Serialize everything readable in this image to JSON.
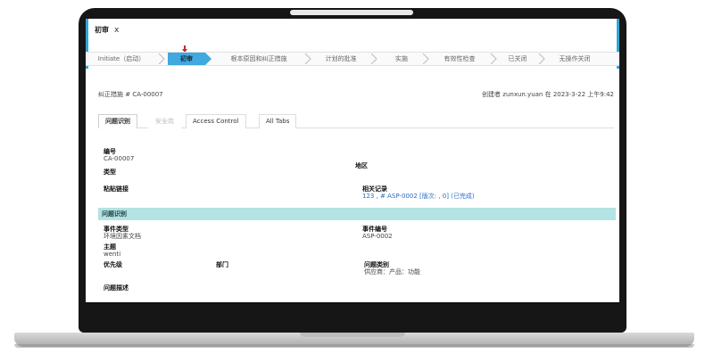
{
  "tab": {
    "label": "初审",
    "close": "x"
  },
  "path": {
    "stages": [
      {
        "label": "Initiate（启动）",
        "active": false
      },
      {
        "label": "初审",
        "active": true
      },
      {
        "label": "根本原因和纠正措施",
        "active": false
      },
      {
        "label": "计划的批准",
        "active": false
      },
      {
        "label": "实施",
        "active": false
      },
      {
        "label": "有效性检查",
        "active": false
      },
      {
        "label": "已关闭",
        "active": false
      },
      {
        "label": "无操作关闭",
        "active": false
      }
    ]
  },
  "record": {
    "title": "纠正措施 # CA-00007",
    "created": "创建者 zunxun.yuan 在  2023-3-22 上午9:42"
  },
  "tabs": [
    {
      "label": "问题识别",
      "state": "active"
    },
    {
      "label": "安全岗",
      "state": "muted"
    },
    {
      "label": "Access Control",
      "state": "normal"
    },
    {
      "label": "All Tabs",
      "state": "normal"
    }
  ],
  "fields": {
    "number_label": "编号",
    "number_value": "CA-00007",
    "type_label": "类型",
    "region_label": "地区",
    "paste_link_label": "粘贴链接",
    "related_label": "相关记录",
    "related_value": "123 , # ASP-0002 [版次: , 0] (已完成)"
  },
  "section": {
    "title": "问题识别"
  },
  "details": {
    "event_type_label": "事件类型",
    "event_type_value": "环境因素文档",
    "event_number_label": "事件编号",
    "event_number_value": "ASP-0002",
    "subject_label": "主题",
    "subject_value": "wenti",
    "priority_label": "优先级",
    "department_label": "部门",
    "category_label": "问题类别",
    "category_value": "供应商：产品：功能",
    "description_label": "问题描述"
  },
  "colors": {
    "accent": "#3fa9e0",
    "section_bg": "#b4e3e3",
    "marker": "#c62828"
  }
}
